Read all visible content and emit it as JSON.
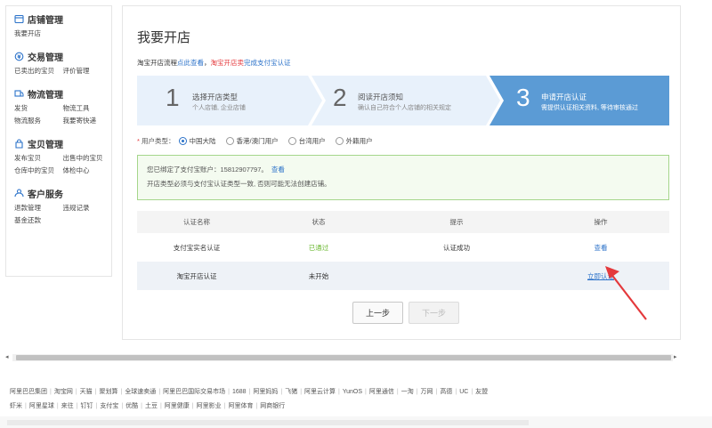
{
  "sidebar": {
    "groups": [
      {
        "title": "店铺管理",
        "icon": "store-icon",
        "links": [
          "我要开店"
        ]
      },
      {
        "title": "交易管理",
        "icon": "trade-icon",
        "links": [
          "已卖出的宝贝",
          "评价管理"
        ]
      },
      {
        "title": "物流管理",
        "icon": "logistics-icon",
        "links": [
          "发货",
          "物流工具",
          "物流服务",
          "我要寄快递"
        ]
      },
      {
        "title": "宝贝管理",
        "icon": "goods-icon",
        "links": [
          "发布宝贝",
          "出售中的宝贝",
          "仓库中的宝贝",
          "体检中心"
        ]
      },
      {
        "title": "客户服务",
        "icon": "service-icon",
        "links": [
          "退款管理",
          "违规记录",
          "基金还款"
        ]
      }
    ]
  },
  "main": {
    "title": "我要开店",
    "flow_note": {
      "prefix": "淘宝开店流程",
      "link1": "点此查看",
      "sep": "，",
      "red": "淘宝开店卖",
      "link2": "完成支付宝认证"
    },
    "steps": [
      {
        "num": "1",
        "title": "选择开店类型",
        "sub": "个人店铺, 企业店铺"
      },
      {
        "num": "2",
        "title": "阅读开店须知",
        "sub": "确认自己符合个人店铺的相关规定"
      },
      {
        "num": "3",
        "title": "申请开店认证",
        "sub": "需提供认证相关资料, 等待审核通过"
      }
    ],
    "user_type": {
      "label": "用户类型：",
      "options": [
        "中国大陆",
        "香港/澳门用户",
        "台湾用户",
        "外籍用户"
      ],
      "selected": "中国大陆"
    },
    "notice": {
      "line1": "您已绑定了支付宝账户：15812907797。",
      "line1_link": "查看",
      "line2": "开店类型必须与支付宝认证类型一致, 否则可能无法创建店铺。"
    },
    "table": {
      "headers": [
        "认证名称",
        "状态",
        "提示",
        "操作"
      ],
      "rows": [
        {
          "name": "支付宝实名认证",
          "status": "已通过",
          "tip": "认证成功",
          "action": "查看"
        },
        {
          "name": "淘宝开店认证",
          "status": "未开始",
          "tip": "",
          "action": "立即认证"
        }
      ]
    },
    "buttons": {
      "prev": "上一步",
      "next": "下一步"
    }
  },
  "footer": {
    "row1": [
      "阿里巴巴集团",
      "淘宝网",
      "天猫",
      "聚划算",
      "全球速卖通",
      "阿里巴巴国际交易市场",
      "1688",
      "阿里妈妈",
      "飞猪",
      "阿里云计算",
      "YunOS",
      "阿里通信",
      "一淘",
      "万网",
      "高德",
      "UC",
      "友盟"
    ],
    "row2": [
      "虾米",
      "阿里星球",
      "来往",
      "钉钉",
      "支付宝",
      "优酷",
      "土豆",
      "阿里健康",
      "阿里影业",
      "阿里体育",
      "网商银行"
    ]
  },
  "colors": {
    "accent": "#2b72c9",
    "step_inactive": "#e8f1fb",
    "step_active": "#5b9bd5",
    "success": "#6bb831",
    "annotation_arrow": "#e4393c"
  }
}
